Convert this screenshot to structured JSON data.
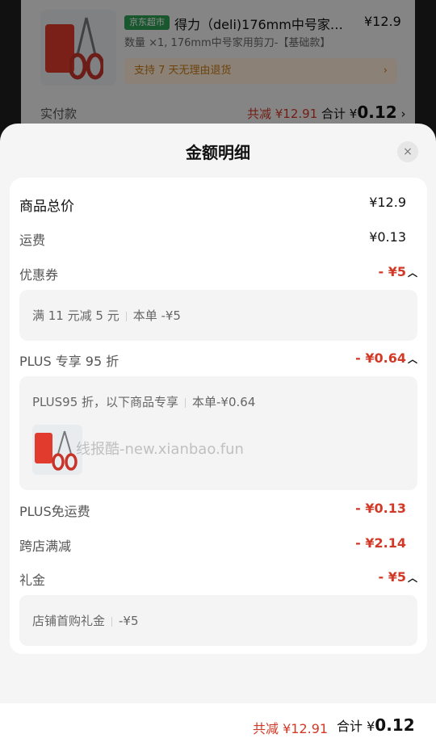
{
  "order": {
    "badge": "京东超市",
    "title": "得力（deli)176mm中号家…",
    "price": "¥12.9",
    "spec": "数量 ×1, 176mm中号家用剪刀-【基础款】",
    "return_note": "支持 7 天无理由退货",
    "pay_label": "实付款",
    "discount": "共减 ¥12.91",
    "total_prefix": "合计 ¥",
    "total_value": "0.12"
  },
  "sheet": {
    "title": "金额明细",
    "close": "×"
  },
  "rows": {
    "goods": {
      "label": "商品总价",
      "value": "¥12.9"
    },
    "shipping": {
      "label": "运费",
      "value": "¥0.13"
    },
    "coupon": {
      "label": "优惠券",
      "value": "- ¥5",
      "detail_a": "满 11 元减 5 元",
      "detail_b": "本单 -¥5"
    },
    "plus95": {
      "label": "PLUS 专享 95 折",
      "value": "- ¥0.64",
      "detail_a": "PLUS95 折，以下商品专享",
      "detail_b": "本单-¥0.64"
    },
    "plus_free_ship": {
      "label": "PLUS免运费",
      "value": "- ¥0.13"
    },
    "cross_store": {
      "label": "跨店满减",
      "value": "- ¥2.14"
    },
    "gift": {
      "label": "礼金",
      "value": "- ¥5",
      "detail_a": "店铺首购礼金",
      "detail_b": "-¥5"
    }
  },
  "watermark": "线报酷-new.xianbao.fun",
  "footer": {
    "discount": "共减 ¥12.91",
    "total_prefix": "合计 ¥",
    "total_value": "0.12"
  }
}
